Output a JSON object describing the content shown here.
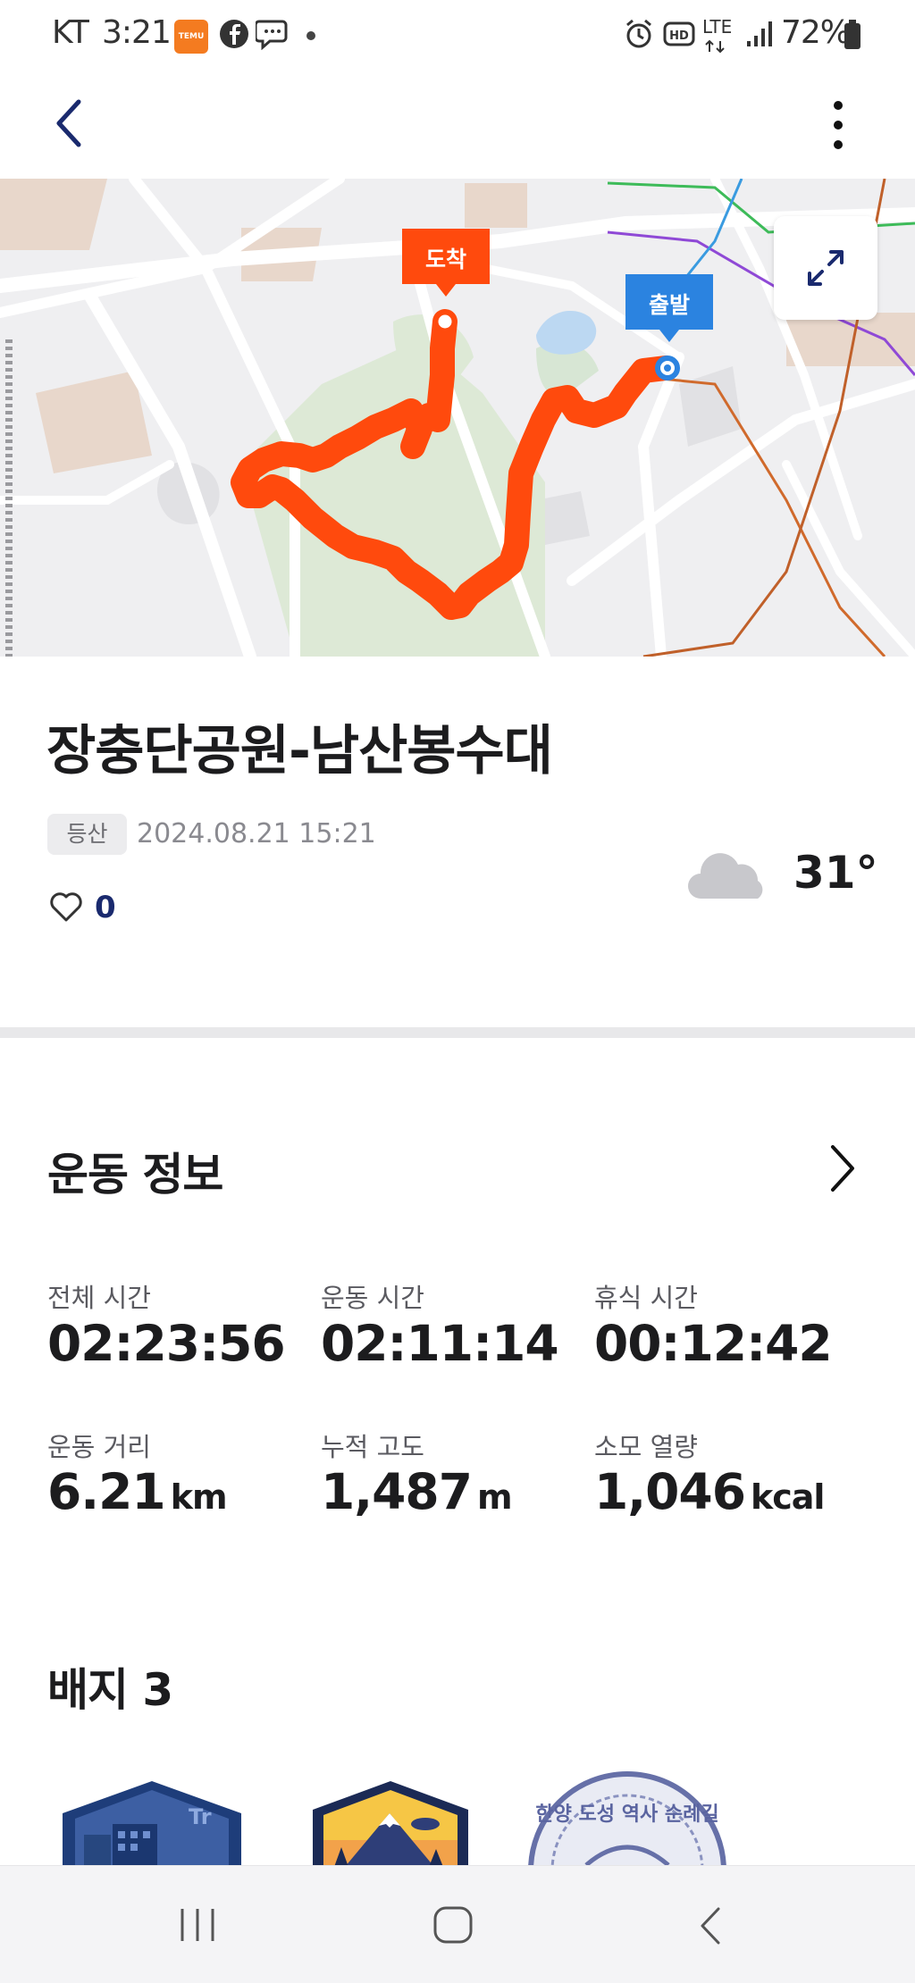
{
  "status_bar": {
    "carrier": "KT",
    "time": "3:21",
    "temu_label": "TEMU",
    "network": "LTE",
    "battery": "72%"
  },
  "map": {
    "start_label": "출발",
    "end_label": "도착",
    "route_color": "#ff4a0d",
    "start_color": "#2b83e0"
  },
  "activity": {
    "title": "장충단공원-남산봉수대",
    "category_badge": "등산",
    "datetime": "2024.08.21 15:21",
    "likes": "0",
    "temperature": "31°"
  },
  "workout": {
    "section_title": "운동 정보",
    "stats": [
      {
        "label": "전체 시간",
        "value": "02:23:56",
        "unit": ""
      },
      {
        "label": "운동 시간",
        "value": "02:11:14",
        "unit": ""
      },
      {
        "label": "휴식 시간",
        "value": "00:12:42",
        "unit": ""
      },
      {
        "label": "운동 거리",
        "value": "6.21",
        "unit": "km"
      },
      {
        "label": "누적 고도",
        "value": "1,487",
        "unit": "m"
      },
      {
        "label": "소모 열량",
        "value": "1,046",
        "unit": "kcal"
      }
    ]
  },
  "badges": {
    "section_title": "배지 3",
    "stamp_text": "한양 도성 역사 순례길"
  }
}
